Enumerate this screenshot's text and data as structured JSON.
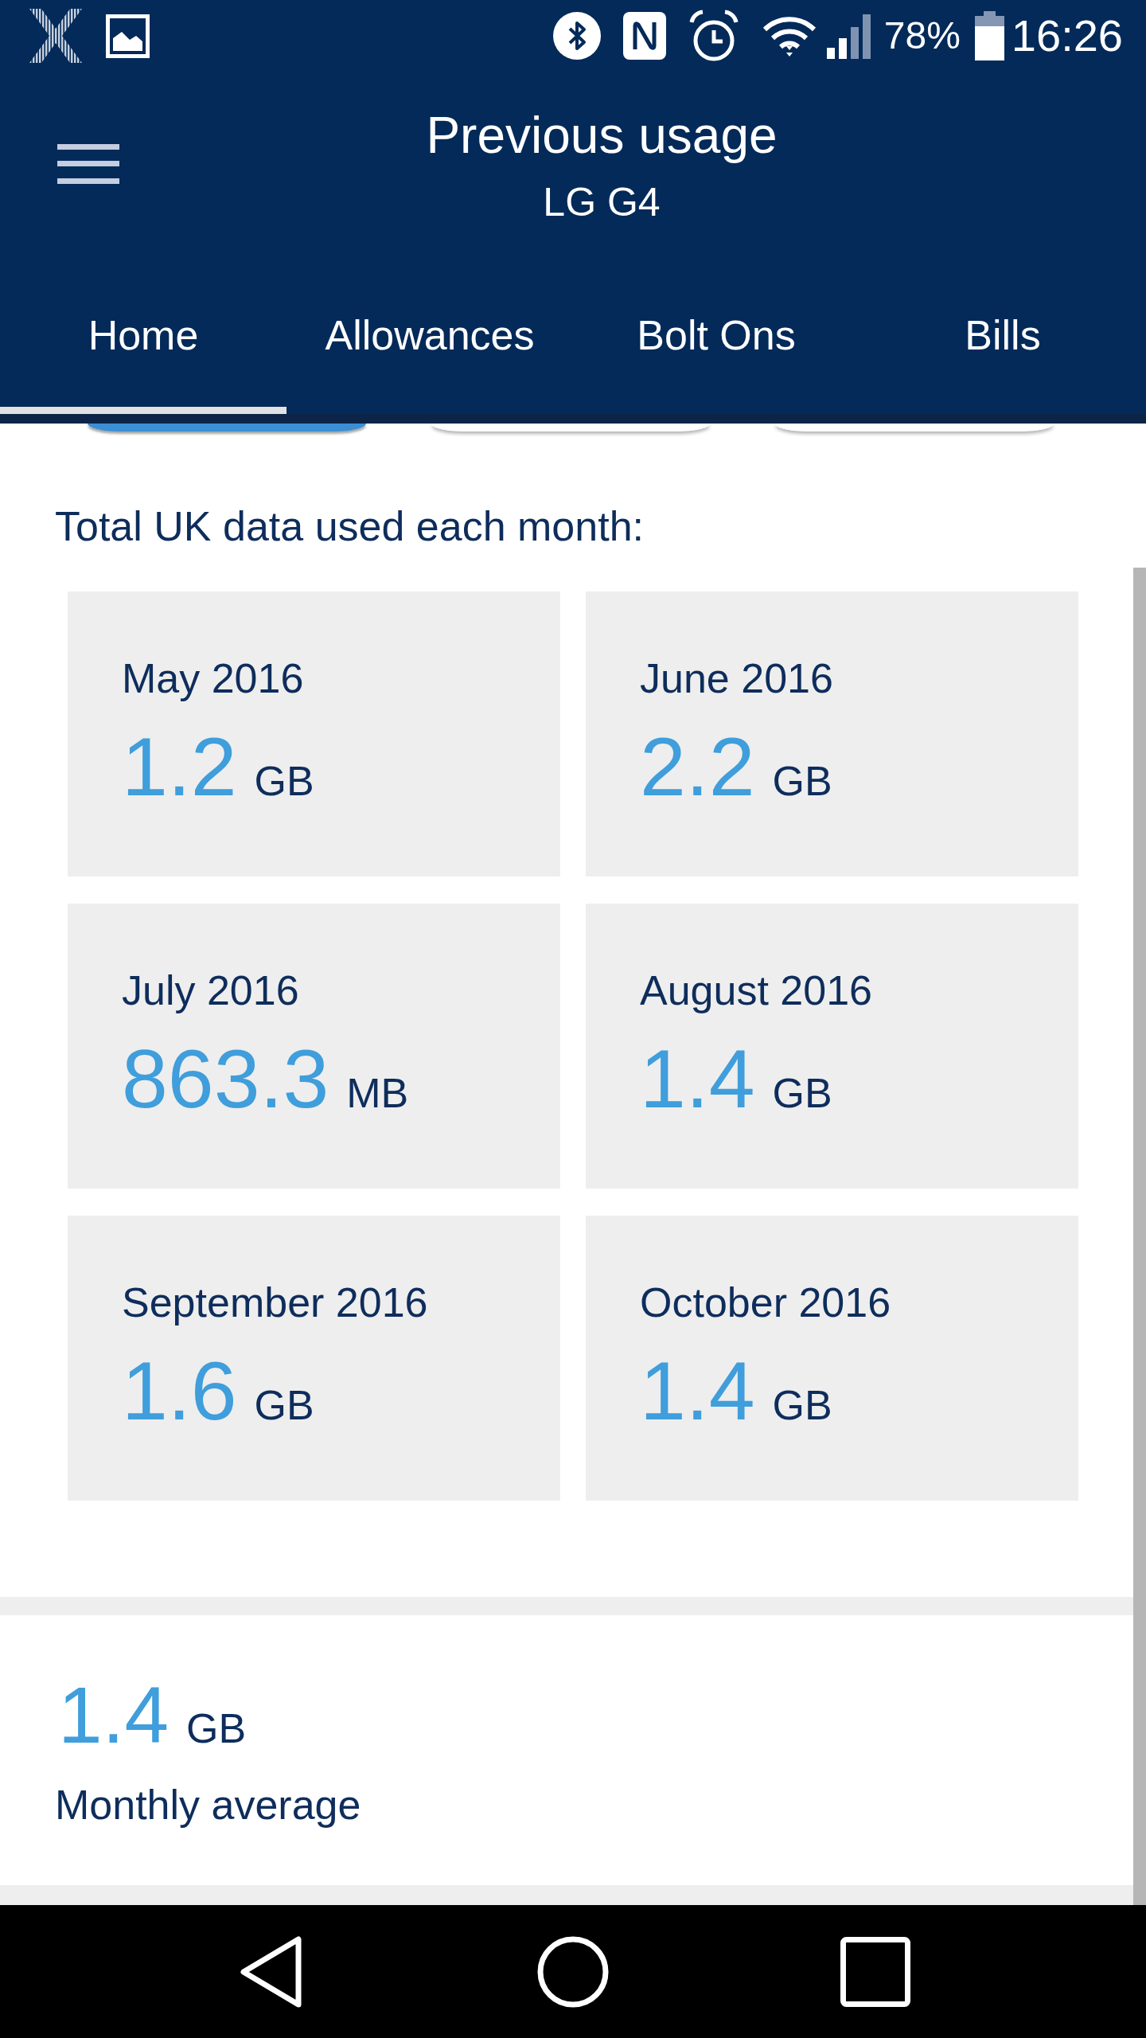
{
  "status_bar": {
    "battery_percent": "78%",
    "time": "16:26"
  },
  "header": {
    "title": "Previous usage",
    "subtitle": "LG G4"
  },
  "tabs": [
    {
      "label": "Home",
      "selected": true
    },
    {
      "label": "Allowances",
      "selected": false
    },
    {
      "label": "Bolt Ons",
      "selected": false
    },
    {
      "label": "Bills",
      "selected": false
    }
  ],
  "segment_buttons": [
    {
      "selected": true
    },
    {
      "selected": false
    },
    {
      "selected": false
    }
  ],
  "usage": {
    "heading": "Total UK data used each month:",
    "months": [
      {
        "month": "May 2016",
        "value": "1.2",
        "unit": "GB"
      },
      {
        "month": "June 2016",
        "value": "2.2",
        "unit": "GB"
      },
      {
        "month": "July 2016",
        "value": "863.3",
        "unit": "MB"
      },
      {
        "month": "August 2016",
        "value": "1.4",
        "unit": "GB"
      },
      {
        "month": "September 2016",
        "value": "1.6",
        "unit": "GB"
      },
      {
        "month": "October 2016",
        "value": "1.4",
        "unit": "GB"
      }
    ]
  },
  "average": {
    "value": "1.4",
    "unit": "GB",
    "label": "Monthly average"
  }
}
